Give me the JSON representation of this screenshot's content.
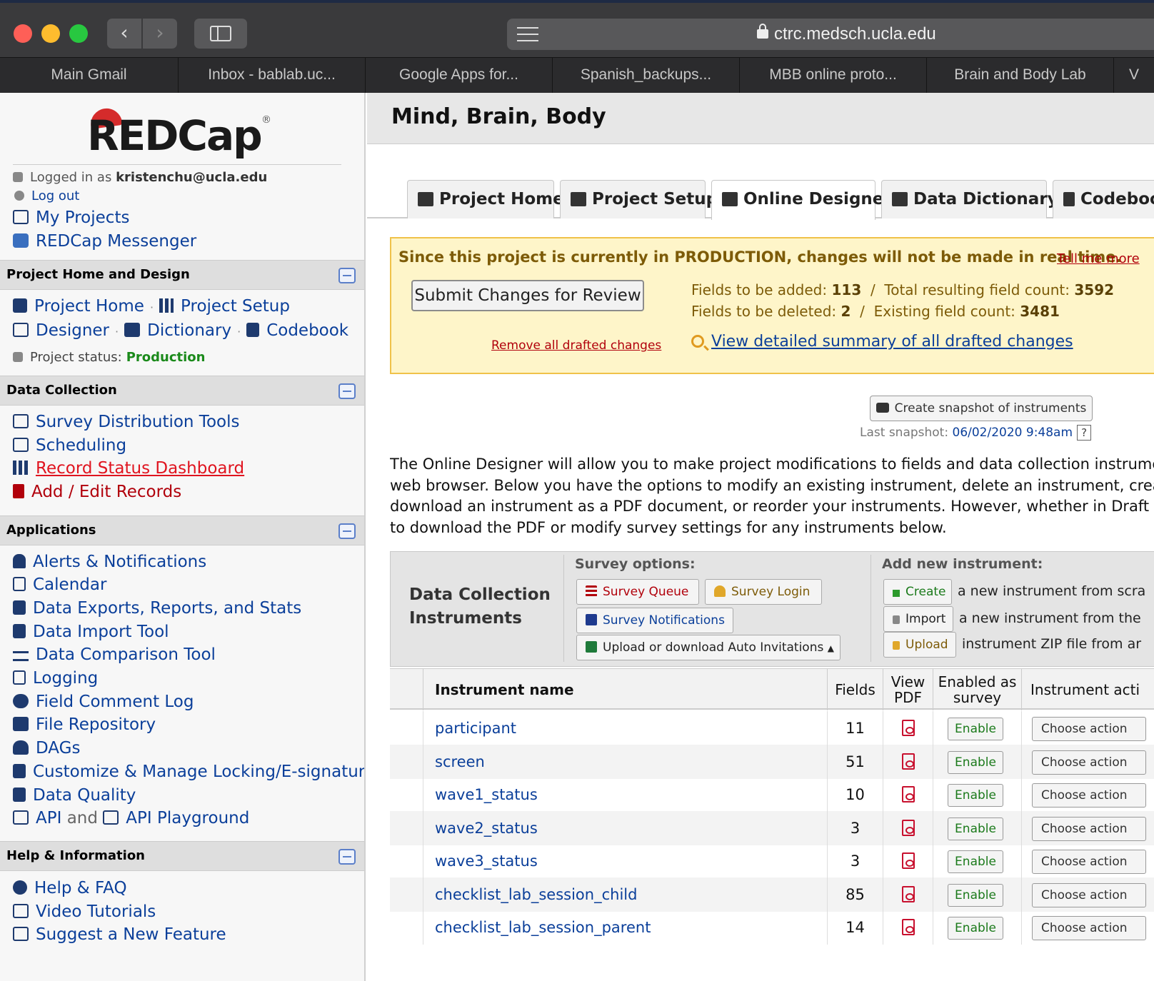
{
  "browser": {
    "url": "ctrc.medsch.ucla.edu",
    "bookmarks": [
      "Main Gmail",
      "Inbox - bablab.uc...",
      "Google Apps for...",
      "Spanish_backups...",
      "MBB online proto...",
      "Brain and Body Lab",
      "V"
    ]
  },
  "sidebar": {
    "logo": "REDCap",
    "logged_in_prefix": "Logged in as",
    "username": "kristenchu@ucla.edu",
    "logout": "Log out",
    "my_projects": "My Projects",
    "messenger": "REDCap Messenger",
    "sections": {
      "design": {
        "title": "Project Home and Design",
        "project_home": "Project Home",
        "project_setup": "Project Setup",
        "designer": "Designer",
        "dictionary": "Dictionary",
        "codebook": "Codebook",
        "status_label": "Project status:",
        "status_value": "Production"
      },
      "collection": {
        "title": "Data Collection",
        "items": [
          "Survey Distribution Tools",
          "Scheduling",
          "Record Status Dashboard",
          "Add / Edit Records"
        ]
      },
      "applications": {
        "title": "Applications",
        "items": [
          "Alerts & Notifications",
          "Calendar",
          "Data Exports, Reports, and Stats",
          "Data Import Tool",
          "Data Comparison Tool",
          "Logging",
          "Field Comment Log",
          "File Repository",
          "DAGs",
          "Customize & Manage Locking/E-signatures",
          "Data Quality"
        ],
        "api": "API",
        "api_and": "and",
        "api_playground": "API Playground"
      },
      "help": {
        "title": "Help & Information",
        "items": [
          "Help & FAQ",
          "Video Tutorials",
          "Suggest a New Feature"
        ]
      }
    }
  },
  "main": {
    "title": "Mind, Brain, Body",
    "tabs": [
      "Project Home",
      "Project Setup",
      "Online Designer",
      "Data Dictionary",
      "Codeboo"
    ],
    "production_notice": {
      "message": "Since this project is currently in PRODUCTION, changes will not be made in real time.",
      "tell_more": "Tell me more",
      "submit": "Submit Changes for Review",
      "remove": "Remove all drafted changes",
      "fields_added_label": "Fields to be added:",
      "fields_added": "113",
      "total_label": "Total resulting field count:",
      "total": "3592",
      "fields_deleted_label": "Fields to be deleted:",
      "fields_deleted": "2",
      "existing_label": "Existing field count:",
      "existing": "3481",
      "summary_link": "View detailed summary of all drafted changes"
    },
    "snapshot": {
      "button": "Create snapshot of instruments",
      "last_label": "Last snapshot:",
      "last_value": "06/02/2020 9:48am",
      "help": "?"
    },
    "description": [
      "The Online Designer will allow you to make project modifications to fields and data collection instrument",
      "web browser. Below you have the options to modify an existing instrument, delete an instrument, create",
      "download an instrument as a PDF document, or reorder your instruments. However, whether in Draft Mo",
      "to download the PDF or modify survey settings for any instruments below."
    ],
    "panel": {
      "title_line1": "Data Collection",
      "title_line2": "Instruments",
      "survey_options_label": "Survey options:",
      "survey_queue": "Survey Queue",
      "survey_login": "Survey Login",
      "survey_notifications": "Survey Notifications",
      "auto_invitations": "Upload or download Auto Invitations",
      "add_new_label": "Add new instrument:",
      "create": "Create",
      "create_desc": "a new instrument from scra",
      "import": "Import",
      "import_desc": "a new instrument from the",
      "upload": "Upload",
      "upload_desc": "instrument ZIP file from ar"
    },
    "table": {
      "headers": {
        "name": "Instrument name",
        "fields": "Fields",
        "view_pdf_1": "View",
        "view_pdf_2": "PDF",
        "enabled_1": "Enabled as",
        "enabled_2": "survey",
        "actions": "Instrument acti"
      },
      "enable_label": "Enable",
      "action_label": "Choose action",
      "rows": [
        {
          "name": "participant",
          "fields": "11"
        },
        {
          "name": "screen",
          "fields": "51"
        },
        {
          "name": "wave1_status",
          "fields": "10"
        },
        {
          "name": "wave2_status",
          "fields": "3"
        },
        {
          "name": "wave3_status",
          "fields": "3"
        },
        {
          "name": "checklist_lab_session_child",
          "fields": "85"
        },
        {
          "name": "checklist_lab_session_parent",
          "fields": "14"
        }
      ]
    }
  }
}
